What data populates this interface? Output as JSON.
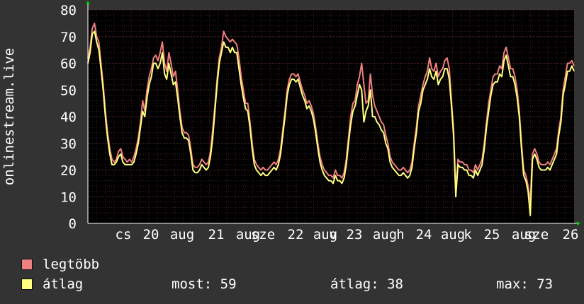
{
  "chart_data": {
    "type": "line",
    "ylabel": "onlinestream.live",
    "ylim": [
      0,
      80
    ],
    "yticks": [
      0,
      10,
      20,
      30,
      40,
      50,
      60,
      70,
      80
    ],
    "x_tick_labels": [
      "cs",
      "20",
      "aug",
      "21",
      "aug",
      "sze",
      "22",
      "aug",
      "v",
      "23",
      "aug",
      "h",
      "24",
      "aug",
      "k",
      "25",
      "aug",
      "sze",
      "26"
    ],
    "grid": true,
    "colors": {
      "legtobb": "#f08080",
      "atlag": "#ffff80",
      "background": "#000000",
      "grid": "#5a2a2a"
    },
    "series": [
      {
        "name": "legtöbb",
        "values": [
          62,
          66,
          73,
          75,
          70,
          68,
          60,
          52,
          42,
          34,
          28,
          24,
          23,
          24,
          27,
          28,
          25,
          24,
          23,
          24,
          23,
          25,
          28,
          32,
          38,
          46,
          42,
          50,
          55,
          58,
          62,
          63,
          61,
          64,
          68,
          60,
          57,
          64,
          60,
          55,
          57,
          50,
          42,
          36,
          34,
          34,
          33,
          28,
          22,
          21,
          21,
          22,
          24,
          23,
          22,
          23,
          27,
          35,
          44,
          54,
          62,
          66,
          72,
          70,
          69,
          68,
          69,
          68,
          67,
          62,
          55,
          50,
          45,
          45,
          38,
          30,
          24,
          22,
          21,
          20,
          21,
          20,
          20,
          21,
          22,
          23,
          22,
          24,
          28,
          35,
          42,
          50,
          54,
          56,
          56,
          55,
          56,
          53,
          50,
          48,
          45,
          46,
          44,
          41,
          36,
          30,
          25,
          22,
          20,
          19,
          18,
          18,
          17,
          20,
          18,
          18,
          17,
          19,
          24,
          32,
          40,
          45,
          46,
          52,
          55,
          60,
          52,
          45,
          46,
          56,
          48,
          44,
          42,
          40,
          38,
          37,
          33,
          30,
          25,
          23,
          22,
          21,
          20,
          20,
          21,
          20,
          19,
          20,
          23,
          30,
          36,
          44,
          48,
          52,
          55,
          57,
          62,
          58,
          57,
          60,
          55,
          57,
          58,
          61,
          62,
          58,
          46,
          35,
          12,
          24,
          23,
          23,
          22,
          22,
          20,
          20,
          19,
          22,
          20,
          22,
          24,
          30,
          38,
          45,
          50,
          55,
          56,
          56,
          59,
          58,
          64,
          66,
          62,
          58,
          58,
          55,
          50,
          42,
          30,
          20,
          18,
          14,
          8,
          26,
          28,
          26,
          23,
          22,
          22,
          22,
          23,
          22,
          24,
          26,
          28,
          35,
          40,
          50,
          55,
          60,
          60,
          61,
          59
        ]
      },
      {
        "name": "átlag",
        "values": [
          60,
          64,
          71,
          72,
          68,
          65,
          58,
          50,
          40,
          32,
          26,
          22,
          22,
          23,
          25,
          26,
          23,
          22,
          22,
          22,
          22,
          23,
          26,
          30,
          36,
          42,
          40,
          47,
          52,
          55,
          60,
          60,
          58,
          60,
          64,
          56,
          54,
          60,
          56,
          52,
          53,
          47,
          40,
          34,
          32,
          32,
          31,
          26,
          20,
          19,
          19,
          20,
          22,
          21,
          20,
          21,
          25,
          32,
          42,
          52,
          60,
          64,
          68,
          66,
          66,
          64,
          66,
          64,
          64,
          58,
          52,
          47,
          43,
          42,
          36,
          28,
          22,
          20,
          19,
          18,
          19,
          18,
          18,
          19,
          20,
          21,
          20,
          22,
          26,
          33,
          40,
          48,
          52,
          54,
          54,
          53,
          54,
          51,
          48,
          46,
          43,
          44,
          42,
          39,
          34,
          28,
          23,
          20,
          18,
          17,
          16,
          16,
          15,
          18,
          16,
          16,
          15,
          17,
          22,
          30,
          37,
          42,
          44,
          48,
          52,
          50,
          38,
          42,
          44,
          50,
          40,
          40,
          38,
          37,
          35,
          34,
          30,
          28,
          23,
          21,
          20,
          19,
          18,
          18,
          19,
          18,
          17,
          18,
          21,
          28,
          34,
          42,
          45,
          50,
          52,
          54,
          58,
          55,
          54,
          57,
          52,
          54,
          55,
          58,
          58,
          54,
          44,
          33,
          10,
          22,
          21,
          21,
          20,
          20,
          18,
          18,
          17,
          20,
          18,
          20,
          22,
          28,
          36,
          42,
          48,
          52,
          53,
          53,
          56,
          55,
          61,
          63,
          59,
          55,
          55,
          52,
          47,
          40,
          28,
          18,
          16,
          12,
          3,
          24,
          26,
          24,
          21,
          20,
          20,
          20,
          21,
          20,
          22,
          24,
          26,
          33,
          38,
          48,
          52,
          57,
          57,
          59,
          57
        ]
      }
    ]
  },
  "legend": {
    "max_label": "legtöbb",
    "avg_label": "átlag",
    "stat_now": "most: 59",
    "stat_avg": "átlag: 38",
    "stat_max": "max: 73"
  }
}
